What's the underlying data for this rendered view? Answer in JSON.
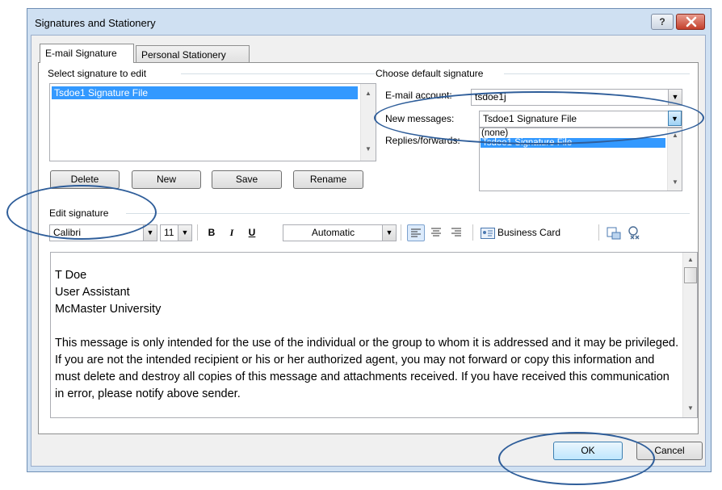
{
  "window": {
    "title": "Signatures and Stationery",
    "help_label": "?",
    "close_label": "✕"
  },
  "tabs": [
    {
      "label": "E-mail Signature",
      "active": true
    },
    {
      "label": "Personal Stationery",
      "active": false
    }
  ],
  "select_signature": {
    "heading": "Select signature to edit",
    "items": [
      "Tsdoe1 Signature File"
    ],
    "buttons": {
      "delete": "Delete",
      "new": "New",
      "save": "Save",
      "rename": "Rename"
    }
  },
  "default_signature": {
    "heading": "Choose default signature",
    "email_account_label": "E-mail account:",
    "email_account_value": "tsdoe1j",
    "new_messages_label": "New messages:",
    "new_messages_value": "Tsdoe1 Signature File",
    "replies_label": "Replies/forwards:",
    "dropdown_options": [
      "(none)",
      "Tsdoe1 Signature File"
    ]
  },
  "edit_signature": {
    "heading": "Edit signature",
    "font": "Calibri",
    "size": "11",
    "bold": "B",
    "italic": "I",
    "underline": "U",
    "color": "Automatic",
    "business_card": "Business Card",
    "lines": [
      "T Doe",
      "User Assistant",
      "McMaster University"
    ],
    "disclaimer": "This message is only intended for the use of the individual or the group to whom it is addressed and it may be privileged. If you are not the intended recipient or his or her authorized agent, you may not forward or copy this information and must delete and destroy all copies of this message and attachments received. If you have received this communication in error, please notify above sender."
  },
  "footer": {
    "ok": "OK",
    "cancel": "Cancel"
  },
  "colors": {
    "selection": "#3399ff",
    "annotation": "#2f5e9a",
    "frame": "#cfe0f2"
  },
  "icons": [
    "help-icon",
    "close-icon",
    "align-left-icon",
    "align-center-icon",
    "align-right-icon",
    "business-card-icon",
    "insert-picture-icon",
    "hyperlink-icon"
  ]
}
